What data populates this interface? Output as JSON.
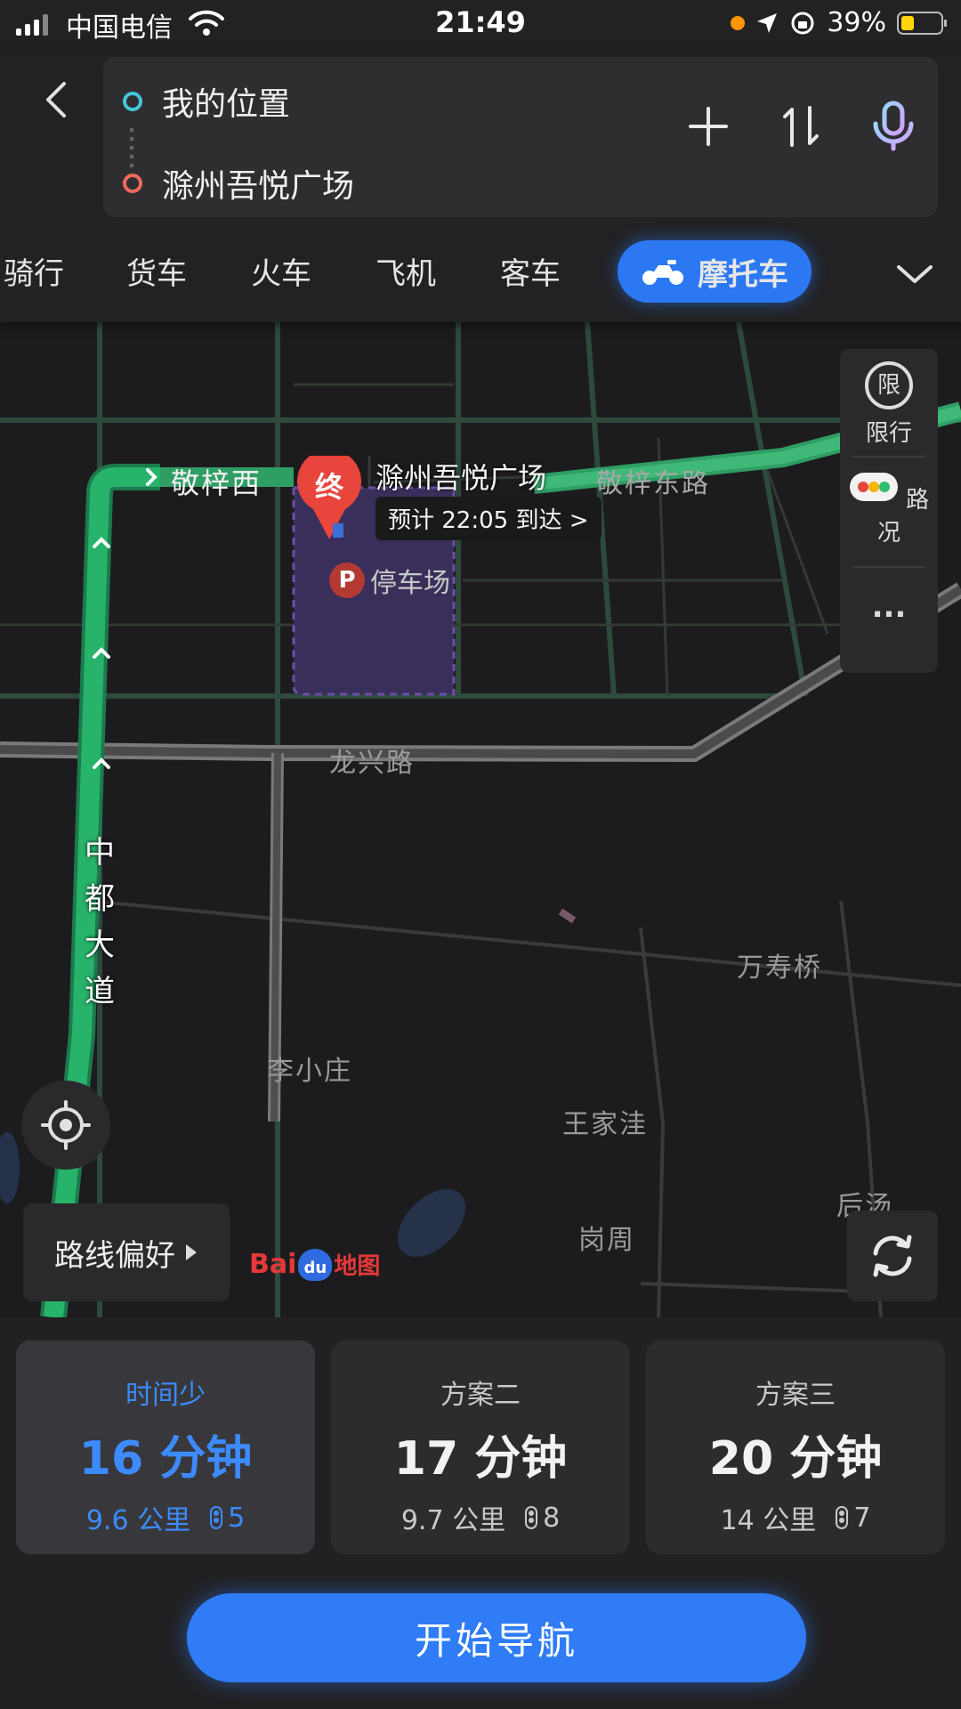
{
  "status_bar": {
    "carrier": "中国电信",
    "time": "21:49",
    "battery": "39%"
  },
  "route": {
    "from": "我的位置",
    "to": "滁州吾悦广场"
  },
  "modes": [
    {
      "label": "骑行"
    },
    {
      "label": "货车"
    },
    {
      "label": "火车"
    },
    {
      "label": "飞机"
    },
    {
      "label": "客车"
    },
    {
      "label": "摩托车",
      "active": true
    }
  ],
  "map": {
    "destination_name": "滁州吾悦广场",
    "eta": "预计 22:05 到达 >",
    "parking": "停车场",
    "end_marker": "终",
    "roads": {
      "jingzi_west": "敬梓西",
      "jingzi_east": "敬梓东路",
      "longxing": "龙兴路",
      "zhongdu": [
        "中",
        "都",
        "大",
        "道"
      ]
    },
    "places": {
      "wanshouqiao": "万寿桥",
      "lixiaozhuang": "李小庄",
      "wangjiawa": "王家洼",
      "gangzhou": "岗周",
      "houtang": "后汤"
    },
    "tools": {
      "restriction_icon": "限",
      "restriction": "限行",
      "traffic": "路况",
      "more": "..."
    },
    "route_pref": "路线偏好",
    "logo_bai": "Bai",
    "logo_du": "du",
    "logo_map": "地图"
  },
  "plans": [
    {
      "name": "时间少",
      "time": "16 分钟",
      "distance": "9.6 公里",
      "lights": "5",
      "selected": true
    },
    {
      "name": "方案二",
      "time": "17 分钟",
      "distance": "9.7 公里",
      "lights": "8"
    },
    {
      "name": "方案三",
      "time": "20 分钟",
      "distance": "14 公里",
      "lights": "7"
    }
  ],
  "start_button": "开始导航",
  "colors": {
    "accent": "#2f7cf6",
    "route_green": "#27b36a",
    "destination_red": "#e8453c"
  }
}
